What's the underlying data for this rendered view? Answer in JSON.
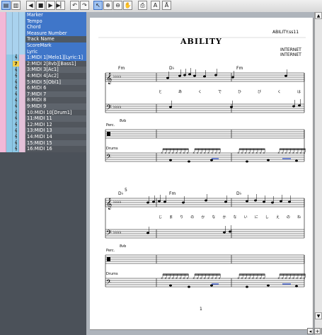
{
  "toolbar": {
    "buttons": [
      {
        "name": "view-page-button",
        "icon": "page-icon",
        "glyph": "▤",
        "active": true
      },
      {
        "name": "view-mode-button",
        "icon": "layout-icon",
        "glyph": "▥",
        "active": false
      },
      {
        "name": "rewind-button",
        "icon": "rewind-icon",
        "glyph": "◀",
        "active": false
      },
      {
        "name": "stop-button",
        "icon": "stop-icon",
        "glyph": "■",
        "active": false
      },
      {
        "name": "play-button",
        "icon": "play-icon",
        "glyph": "▶",
        "active": false
      },
      {
        "name": "forward-end-button",
        "icon": "end-icon",
        "glyph": "▶▏",
        "active": false
      },
      {
        "name": "undo-button",
        "icon": "undo-icon",
        "glyph": "↶",
        "active": false
      },
      {
        "name": "redo-button",
        "icon": "redo-icon",
        "glyph": "↷",
        "active": false
      },
      {
        "name": "select-tool-button",
        "icon": "arrow-cursor-icon",
        "glyph": "↖",
        "active": true
      },
      {
        "name": "zoom-in-button",
        "icon": "zoom-in-icon",
        "glyph": "⊕",
        "active": false
      },
      {
        "name": "zoom-out-button",
        "icon": "zoom-out-icon",
        "glyph": "⊖",
        "active": false
      },
      {
        "name": "hand-tool-button",
        "icon": "hand-icon",
        "glyph": "✋",
        "active": false
      },
      {
        "name": "print-button",
        "icon": "print-icon",
        "glyph": "⎙",
        "active": false
      },
      {
        "name": "text-tool-button",
        "icon": "text-icon",
        "glyph": "A",
        "active": false
      },
      {
        "name": "text-style-button",
        "icon": "text-style-icon",
        "glyph": "Ā",
        "active": false
      }
    ]
  },
  "tracks": {
    "meta": [
      {
        "label": "Marker"
      },
      {
        "label": "Tempo"
      },
      {
        "label": "Chord"
      },
      {
        "label": "Measure Number"
      },
      {
        "label": "Track Name",
        "dark": true
      },
      {
        "label": "ScoreMark"
      },
      {
        "label": "Lyric"
      }
    ],
    "midi": [
      {
        "label": "1:MIDI 1[Melo1][Lyric:1]",
        "badge": "",
        "sel": true
      },
      {
        "label": "2:MIDI 2[8vb][Bass1]",
        "badge": "7",
        "sel": true
      },
      {
        "label": "3:MIDI 3[Ac1]",
        "badge": "",
        "sel": false
      },
      {
        "label": "4:MIDI 4[Ac2]",
        "badge": "",
        "sel": false
      },
      {
        "label": "5:MIDI 5[Obl1]",
        "badge": "",
        "sel": false
      },
      {
        "label": "6:MIDI 6",
        "badge": "",
        "sel": false
      },
      {
        "label": "7:MIDI 7",
        "badge": "",
        "sel": false
      },
      {
        "label": "8:MIDI 8",
        "badge": "",
        "sel": false
      },
      {
        "label": "9:MIDI 9",
        "badge": "",
        "sel": false
      },
      {
        "label": "10:MIDI 10[Drum1]",
        "badge": "",
        "sel": true
      },
      {
        "label": "11:MIDI 11",
        "badge": "",
        "sel": false
      },
      {
        "label": "12:MIDI 12",
        "badge": "",
        "sel": false
      },
      {
        "label": "13:MIDI 13",
        "badge": "",
        "sel": false
      },
      {
        "label": "14:MIDI 14",
        "badge": "",
        "sel": false
      },
      {
        "label": "15:MIDI 15",
        "badge": "",
        "sel": false
      },
      {
        "label": "16:MIDI 16",
        "badge": "",
        "sel": false
      }
    ]
  },
  "score": {
    "title": "ABILITY",
    "filename": "ABILITY.ss11",
    "credit1": "INTERNET",
    "credit2": "INTERNET",
    "ottava": "8vb",
    "perc_label": "Perc.",
    "drums_label": "Drums",
    "measure_number": "5",
    "page_number": "1",
    "system1": {
      "chords": [
        "Fm",
        "D♭",
        "Fm"
      ],
      "lyrics": [
        "と",
        "あ",
        "く",
        "で",
        "ひ",
        "び",
        "く",
        "は"
      ]
    },
    "system2": {
      "chords": [
        "D♭",
        "Fm",
        "D♭"
      ],
      "lyrics": [
        "じ",
        "ま",
        "り",
        "の",
        "か",
        "な",
        "か",
        "な",
        "い",
        "に",
        "し",
        "え",
        "の",
        "ね"
      ]
    }
  },
  "scrollbar": {
    "up_arrow": "▲",
    "down_arrow": "▼"
  },
  "zoom": {
    "labels": [
      "◂",
      "+",
      "−"
    ]
  }
}
